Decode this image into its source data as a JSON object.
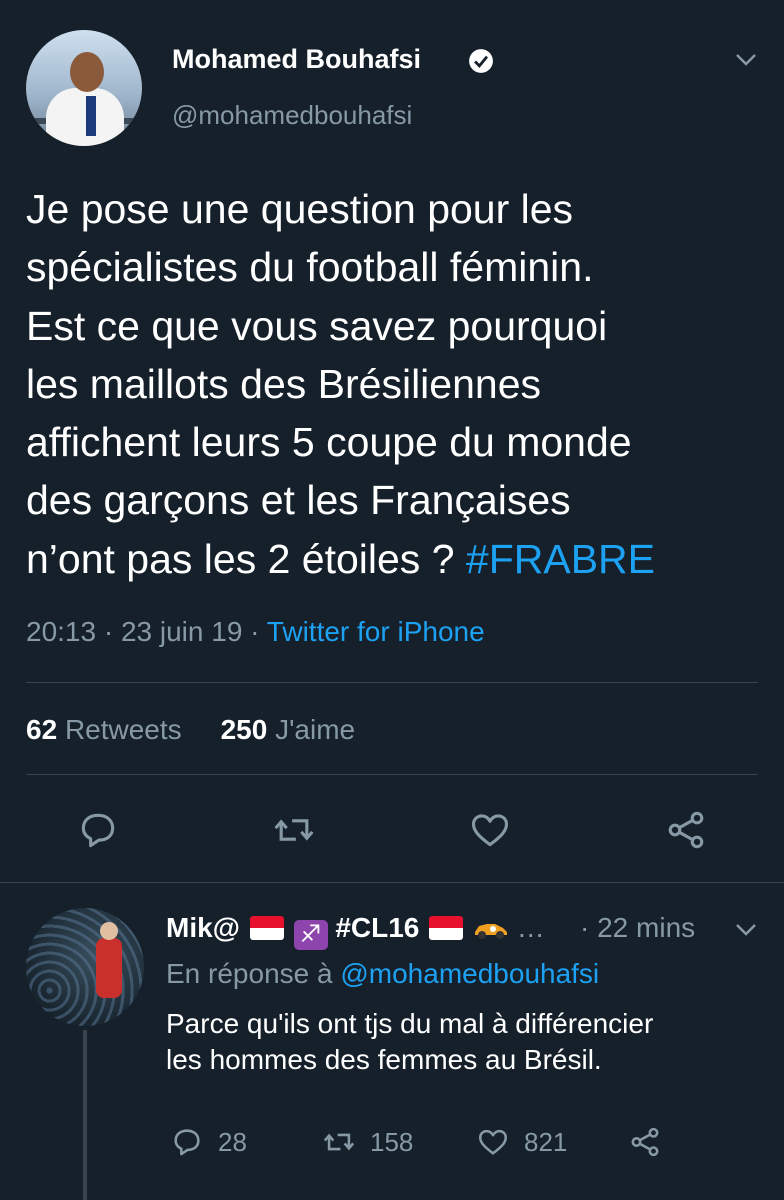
{
  "tweet": {
    "author_name": "Mohamed Bouhafsi",
    "handle": "@mohamedbouhafsi",
    "text_lines": [
      "Je pose une question pour les",
      "spécialistes du football féminin.",
      "Est ce que vous savez pourquoi",
      "les maillots des Brésiliennes",
      "affichent leurs 5 coupe du monde",
      "des garçons et les Françaises",
      "n’ont pas les 2 étoiles ? "
    ],
    "hashtag": "#FRABRE",
    "time": "20:13",
    "date": "23 juin 19",
    "source": "Twitter for iPhone",
    "retweets_count": "62",
    "retweets_label": "Retweets",
    "likes_count": "250",
    "likes_label": "J'aime"
  },
  "reply": {
    "name_prefix": "Mik@",
    "name_tag": "#CL16",
    "ellipsis": "…",
    "time": "22 mins",
    "reply_to_label": "En réponse à",
    "reply_to_handle": "@mohamedbouhafsi",
    "text_lines": [
      "Parce qu'ils ont tjs du mal à différencier",
      "les hommes des femmes au Brésil."
    ],
    "replies_count": "28",
    "retweets_count": "158",
    "likes_count": "821"
  },
  "colors": {
    "background": "#15202b",
    "accent": "#1da1f2",
    "muted": "#8899a6",
    "divider": "#38444d"
  },
  "icons": [
    "verified-icon",
    "chevron-down-icon",
    "reply-icon",
    "retweet-icon",
    "like-icon",
    "share-icon"
  ]
}
